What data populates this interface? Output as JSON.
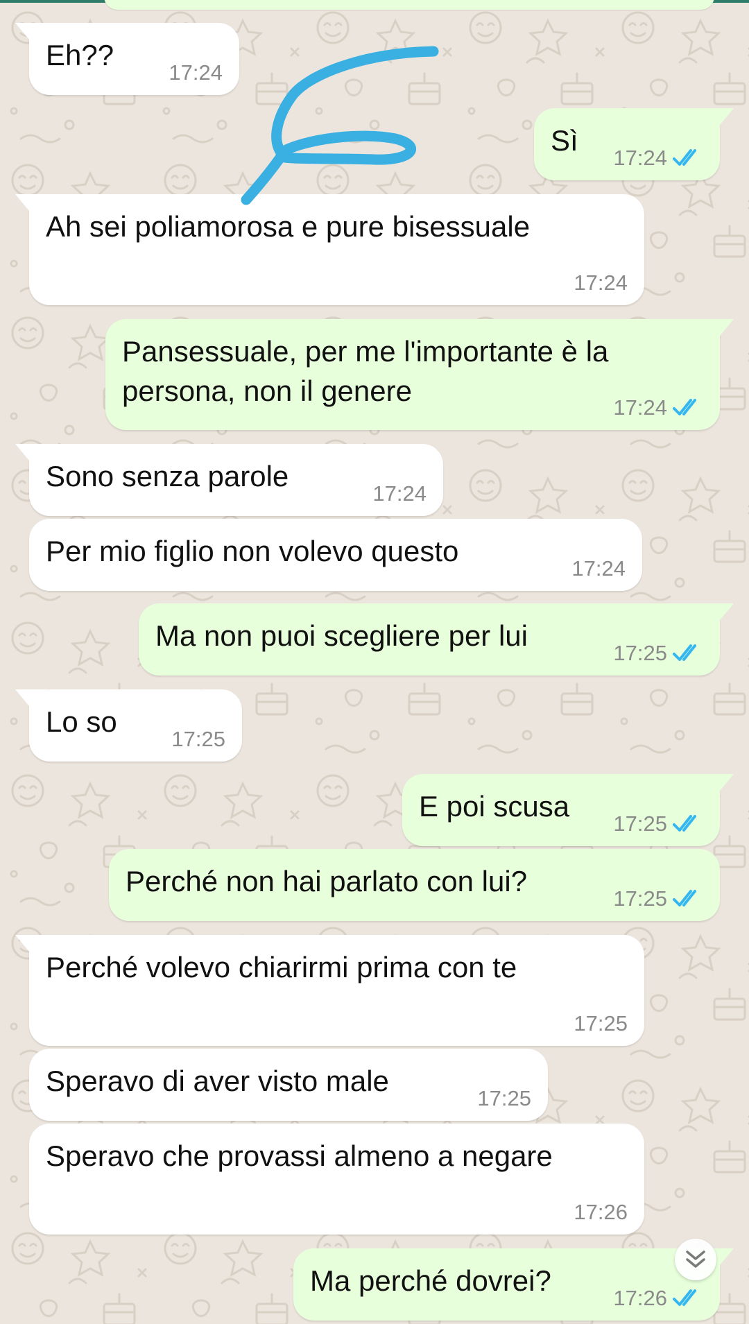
{
  "messages": [
    {
      "text": "Eh??",
      "time": "17:24",
      "side": "in"
    },
    {
      "text": "Sì",
      "time": "17:24",
      "side": "out",
      "status": "read"
    },
    {
      "text": "Ah sei poliamorosa e pure bisessuale",
      "time": "17:24",
      "side": "in"
    },
    {
      "text": "Pansessuale, per me l'importante è la\npersona, non il genere",
      "time": "17:24",
      "side": "out",
      "status": "read"
    },
    {
      "text": "Sono senza parole",
      "time": "17:24",
      "side": "in"
    },
    {
      "text": "Per mio figlio non volevo questo",
      "time": "17:24",
      "side": "in"
    },
    {
      "text": "Ma non puoi scegliere per lui",
      "time": "17:25",
      "side": "out",
      "status": "read"
    },
    {
      "text": "Lo so",
      "time": "17:25",
      "side": "in"
    },
    {
      "text": "E poi scusa",
      "time": "17:25",
      "side": "out",
      "status": "read"
    },
    {
      "text": "Perché non hai parlato con lui?",
      "time": "17:25",
      "side": "out",
      "status": "read"
    },
    {
      "text": "Perché volevo chiarirmi prima con te",
      "time": "17:25",
      "side": "in"
    },
    {
      "text": "Speravo di aver visto male",
      "time": "17:25",
      "side": "in"
    },
    {
      "text": "Speravo che provassi almeno a negare",
      "time": "17:26",
      "side": "in"
    },
    {
      "text": "Ma perché dovrei?",
      "time": "17:26",
      "side": "out",
      "status": "read"
    }
  ],
  "icons": {
    "read_receipt": "double-check-icon",
    "scroll_down": "chevron-double-down-icon",
    "annotation": "blue-pen-scribble"
  },
  "colors": {
    "incoming_bubble": "#FFFFFF",
    "outgoing_bubble": "#E7FFDB",
    "chat_background": "#ECE5DD",
    "read_tick": "#34B7F1",
    "scribble": "#3AAFE2",
    "timestamp": "#8A8A8A"
  }
}
